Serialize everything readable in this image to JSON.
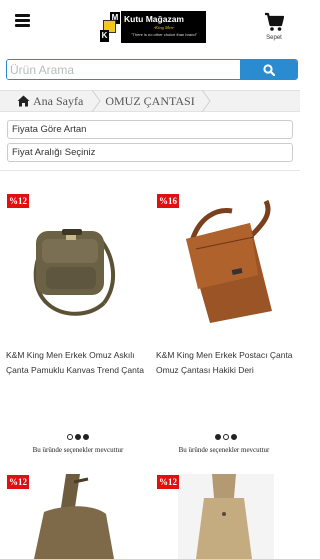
{
  "header": {
    "logo": {
      "km": [
        "K",
        "M"
      ],
      "title": "Kutu Mağazam",
      "subtitle": "-King Men-",
      "slogan": "\"There is no other choice than brand\""
    },
    "cart_label": "Sepet"
  },
  "search": {
    "placeholder": "Ürün Arama"
  },
  "breadcrumb": {
    "home": "Ana Sayfa",
    "current": "OMUZ ÇANTASI"
  },
  "filters": {
    "sort": "Fiyata Göre Artan",
    "price": "Fiyat Aralığı Seçiniz"
  },
  "products": [
    {
      "discount": "%12",
      "name": "K&M King Men Erkek Omuz Askılı Çanta Pamuklu Kanvas Trend Çanta",
      "variants": "Bu üründe seçenekler mevcuttur",
      "active_dot": 2
    },
    {
      "discount": "%16",
      "name": "K&M King Men Erkek Postacı Çanta Omuz Çantası Hakiki Deri",
      "variants": "Bu üründe seçenekler mevcuttur",
      "active_dot": 1
    },
    {
      "discount": "%12"
    },
    {
      "discount": "%12"
    }
  ],
  "colors": {
    "accent": "#2a8bd0",
    "badge": "#e01010",
    "logo_bg": "#000000",
    "logo_yellow": "#f3c81a"
  },
  "icons": [
    "menu-icon",
    "cart-icon",
    "search-icon",
    "home-icon"
  ]
}
